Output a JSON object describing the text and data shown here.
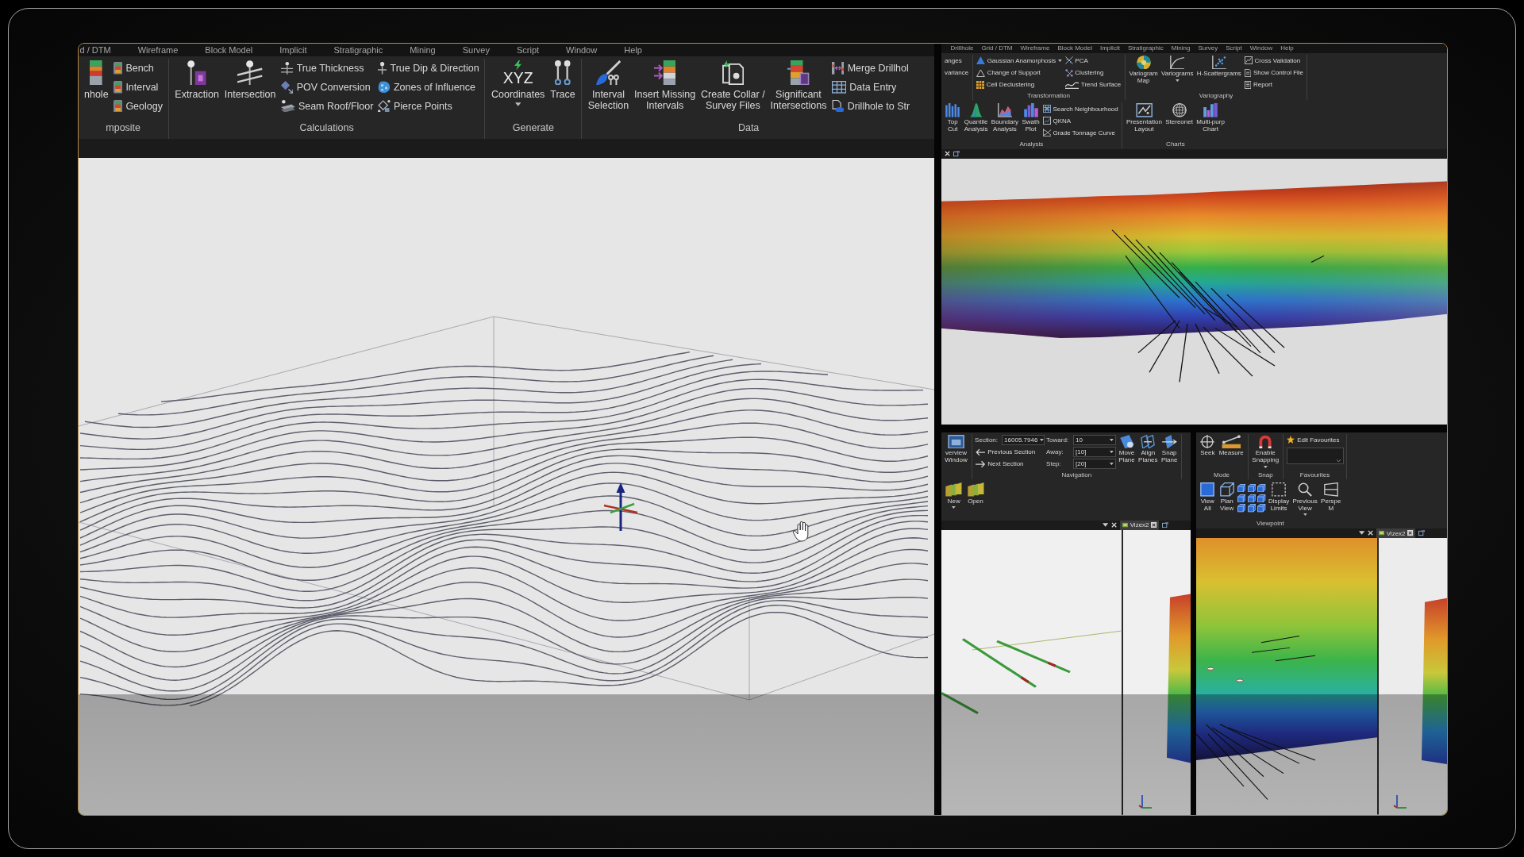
{
  "panels": [
    {
      "kind": "main",
      "menu": [
        "d / DTM",
        "Wireframe",
        "Block Model",
        "Implicit",
        "Stratigraphic",
        "Mining",
        "Survey",
        "Script",
        "Window",
        "Help"
      ],
      "ribbon": [
        {
          "label": "mposite",
          "items": [
            {
              "kind": "large",
              "lines": [
                "nhole"
              ]
            },
            {
              "kind": "stack",
              "items": [
                {
                  "label": "Bench"
                },
                {
                  "label": "Interval"
                },
                {
                  "label": "Geology"
                }
              ]
            }
          ]
        },
        {
          "label": "Calculations",
          "items": [
            {
              "kind": "large",
              "lines": [
                "Extraction"
              ]
            },
            {
              "kind": "large",
              "lines": [
                "Intersection"
              ]
            },
            {
              "kind": "stack",
              "items": [
                {
                  "label": "True Thickness"
                },
                {
                  "label": "POV Conversion"
                },
                {
                  "label": "Seam Roof/Floor"
                }
              ]
            },
            {
              "kind": "stack",
              "items": [
                {
                  "label": "True Dip & Direction"
                },
                {
                  "label": "Zones of Influence"
                },
                {
                  "label": "Pierce Points"
                }
              ]
            }
          ]
        },
        {
          "label": "Generate",
          "items": [
            {
              "kind": "split",
              "glyph": "XYZ",
              "lines": [
                "Coordinates"
              ]
            },
            {
              "kind": "large",
              "lines": [
                "Trace"
              ]
            }
          ]
        },
        {
          "label": "Data",
          "items": [
            {
              "kind": "large",
              "lines": [
                "Interval",
                "Selection"
              ]
            },
            {
              "kind": "large",
              "lines": [
                "Insert Missing",
                "Intervals"
              ]
            },
            {
              "kind": "large",
              "lines": [
                "Create Collar /",
                "Survey Files"
              ]
            },
            {
              "kind": "large",
              "lines": [
                "Significant",
                "Intersections"
              ]
            },
            {
              "kind": "stack",
              "items": [
                {
                  "label": "Merge Drillhol"
                },
                {
                  "label": "Data Entry"
                },
                {
                  "label": "Drillhole to Str"
                }
              ]
            }
          ]
        }
      ]
    },
    {
      "kind": "upper_right",
      "menu": [
        "Drillhole",
        "Grid / DTM",
        "Wireframe",
        "Block Model",
        "Implicit",
        "Stratigraphic",
        "Mining",
        "Survey",
        "Script",
        "Window",
        "Help"
      ],
      "ribbon": [
        {
          "items": [
            {
              "kind": "stack",
              "items": [
                {
                  "label": "anges"
                },
                {
                  "label": "variance"
                }
              ]
            }
          ]
        },
        {
          "label": "Transformation",
          "items": [
            {
              "kind": "stack",
              "items": [
                {
                  "kind": "split",
                  "label": "Gaussian Anamorphosis"
                },
                {
                  "kind": "button",
                  "label": "Change of Support"
                },
                {
                  "kind": "button",
                  "label": "Cell Declustering"
                }
              ]
            },
            {
              "kind": "stack",
              "items": [
                {
                  "label": "PCA"
                },
                {
                  "label": "Clustering"
                },
                {
                  "label": "Trend Surface"
                }
              ]
            }
          ]
        },
        {
          "label": "Variography",
          "items": [
            {
              "kind": "large",
              "lines": [
                "Variogram",
                "Map"
              ]
            },
            {
              "kind": "split",
              "lines": [
                "Variograms"
              ]
            },
            {
              "kind": "large",
              "lines": [
                "H-Scattergrams"
              ]
            },
            {
              "kind": "stack",
              "items": [
                {
                  "label": "Cross Validation"
                },
                {
                  "label": "Show Control File"
                },
                {
                  "label": "Report"
                }
              ]
            }
          ]
        },
        {
          "label": "Analysis",
          "items": [
            {
              "kind": "large",
              "lines": [
                "Top",
                "Cut"
              ]
            },
            {
              "kind": "large",
              "lines": [
                "Quantile",
                "Analysis"
              ]
            },
            {
              "kind": "large",
              "lines": [
                "Boundary",
                "Analysis"
              ]
            },
            {
              "kind": "large",
              "lines": [
                "Swath",
                "Plot"
              ]
            },
            {
              "kind": "stack",
              "items": [
                {
                  "label": "Search Neighbourhood"
                },
                {
                  "label": "QKNA"
                },
                {
                  "label": "Grade Tonnage Curve"
                }
              ]
            }
          ]
        },
        {
          "label": "Charts",
          "items": [
            {
              "kind": "large",
              "lines": [
                "Presentation",
                "Layout"
              ]
            },
            {
              "kind": "large",
              "lines": [
                "Stereonet"
              ]
            },
            {
              "kind": "large",
              "lines": [
                "Multi-purp",
                "Chart"
              ]
            }
          ]
        }
      ]
    },
    {
      "kind": "lower_left",
      "ribbon": [
        {
          "items": [
            {
              "kind": "large",
              "lines": [
                "verview",
                "Window"
              ]
            }
          ]
        },
        {
          "label": "Navigation",
          "items": [
            {
              "kind": "stack",
              "items": [
                {
                  "kind": "field",
                  "label": "Section:",
                  "value": "16005.7946"
                },
                {
                  "kind": "button",
                  "label": "Previous Section"
                },
                {
                  "kind": "button",
                  "label": "Next Section"
                }
              ]
            },
            {
              "kind": "stack",
              "items": [
                {
                  "kind": "field",
                  "label": "Toward:",
                  "value": "10"
                },
                {
                  "kind": "field",
                  "label": "Away:",
                  "value": "[10]"
                },
                {
                  "kind": "field",
                  "label": "Step:",
                  "value": "[20]"
                }
              ]
            },
            {
              "kind": "large",
              "lines": [
                "Move",
                "Plane"
              ]
            },
            {
              "kind": "large",
              "lines": [
                "Align",
                "Planes"
              ]
            },
            {
              "kind": "large",
              "lines": [
                "Snap",
                "Plane"
              ]
            }
          ]
        },
        {
          "items": [
            {
              "kind": "split",
              "lines": [
                "New"
              ]
            },
            {
              "kind": "large",
              "lines": [
                "Open"
              ]
            }
          ]
        }
      ],
      "tabs": [
        {
          "label": "Vizex2",
          "selected": true
        }
      ]
    },
    {
      "kind": "lower_right",
      "ribbon": [
        {
          "label": "Mode",
          "items": [
            {
              "kind": "large",
              "lines": [
                "Seek"
              ]
            },
            {
              "kind": "large",
              "lines": [
                "Measure"
              ]
            }
          ]
        },
        {
          "label": "Snap",
          "items": [
            {
              "kind": "split",
              "lines": [
                "Enable",
                "Snapping"
              ]
            }
          ]
        },
        {
          "label": "Favourites",
          "items": [
            {
              "kind": "stack",
              "items": [
                {
                  "kind": "button",
                  "label": "Edit Favourites"
                },
                {
                  "kind": "dropdown"
                }
              ]
            }
          ]
        },
        {
          "label": "Viewpoint",
          "items": [
            {
              "kind": "large",
              "lines": [
                "View",
                "All"
              ]
            },
            {
              "kind": "large",
              "lines": [
                "Plan",
                "View"
              ]
            },
            {
              "kind": "icon_grid"
            },
            {
              "kind": "large",
              "lines": [
                "Display",
                "Limits"
              ]
            },
            {
              "kind": "split",
              "lines": [
                "Previous",
                "View"
              ]
            },
            {
              "kind": "large",
              "lines": [
                "Perspe",
                "M"
              ]
            }
          ]
        }
      ],
      "tabs": [
        {
          "label": "Vizex2",
          "selected": true
        }
      ]
    }
  ]
}
